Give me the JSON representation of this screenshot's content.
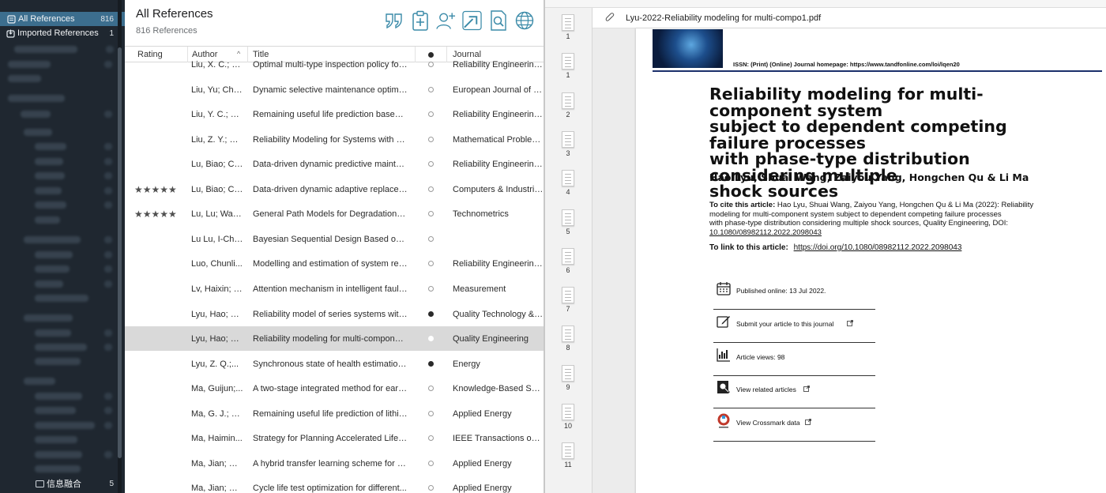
{
  "sidebar": {
    "items": [
      {
        "label": "All References",
        "count": "816",
        "icon": "library-icon",
        "selected": true
      },
      {
        "label": "Imported References",
        "count": "1",
        "icon": "import-icon",
        "selected": false
      }
    ],
    "bottom_label": "信息融合",
    "bottom_count": "5"
  },
  "list": {
    "title": "All References",
    "subtitle": "816 References",
    "toolbar": [
      {
        "name": "quote-icon"
      },
      {
        "name": "clipboard-add-icon"
      },
      {
        "name": "add-user-icon"
      },
      {
        "name": "share-arrow-icon"
      },
      {
        "name": "find-document-icon"
      },
      {
        "name": "globe-icon"
      }
    ],
    "columns": {
      "rating": "Rating",
      "author": "Author",
      "title": "Title",
      "journal": "Journal"
    },
    "rows": [
      {
        "rating": "",
        "author": "Liu, X. C.; S...",
        "title": "Optimal multi-type inspection policy for...",
        "dot": "empty",
        "journal": "Reliability Engineering & ..."
      },
      {
        "rating": "",
        "author": "Liu, Yu; Che...",
        "title": "Dynamic selective maintenance optimiz...",
        "dot": "empty",
        "journal": "European Journal of Oper..."
      },
      {
        "rating": "",
        "author": "Liu, Y. C.; H...",
        "title": "Remaining useful life prediction based o...",
        "dot": "empty",
        "journal": "Reliability Engineering & ..."
      },
      {
        "rating": "",
        "author": "Liu, Z. Y.; M...",
        "title": "Reliability Modeling for Systems with Mu...",
        "dot": "empty",
        "journal": "Mathematical Problems in..."
      },
      {
        "rating": "",
        "author": "Lu, Biao; Ch...",
        "title": "Data-driven dynamic predictive mainten...",
        "dot": "empty",
        "journal": "Reliability Engineering & ..."
      },
      {
        "rating": "★★★★★",
        "author": "Lu, Biao; Ch...",
        "title": "Data-driven dynamic adaptive replacem...",
        "dot": "empty",
        "journal": "Computers & Industrial E..."
      },
      {
        "rating": "★★★★★",
        "author": "Lu, Lu; Wan...",
        "title": "General Path Models for Degradation Da...",
        "dot": "empty",
        "journal": "Technometrics"
      },
      {
        "rating": "",
        "author": "Lu Lu, I-Che...",
        "title": "Bayesian Sequential Design Based on D...",
        "dot": "empty",
        "journal": ""
      },
      {
        "rating": "",
        "author": "Luo, Chunli...",
        "title": "Modelling and estimation of system relia...",
        "dot": "empty",
        "journal": "Reliability Engineering & ..."
      },
      {
        "rating": "",
        "author": "Lv, Haixin; C...",
        "title": "Attention mechanism in intelligent fault...",
        "dot": "empty",
        "journal": "Measurement"
      },
      {
        "rating": "",
        "author": "Lyu, Hao; Q...",
        "title": "Reliability model of series systems with...",
        "dot": "filled",
        "journal": "Quality Technology & Qu..."
      },
      {
        "rating": "",
        "author": "Lyu, Hao; W...",
        "title": "Reliability modeling for multi-componen...",
        "dot": "selected",
        "journal": "Quality Engineering",
        "selected": true
      },
      {
        "rating": "",
        "author": "Lyu, Z. Q.;...",
        "title": "Synchronous state of health estimation...",
        "dot": "filled",
        "journal": "Energy"
      },
      {
        "rating": "",
        "author": "Ma, Guijun;...",
        "title": "A two-stage integrated method for early...",
        "dot": "empty",
        "journal": "Knowledge-Based Systems"
      },
      {
        "rating": "",
        "author": "Ma, G. J.; Z...",
        "title": "Remaining useful life prediction of lithiu...",
        "dot": "empty",
        "journal": "Applied Energy"
      },
      {
        "rating": "",
        "author": "Ma, Haimin...",
        "title": "Strategy for Planning Accelerated Life T...",
        "dot": "empty",
        "journal": "IEEE Transactions on Reli..."
      },
      {
        "rating": "",
        "author": "Ma, Jian; Sh...",
        "title": "A hybrid transfer learning scheme for re...",
        "dot": "empty",
        "journal": "Applied Energy"
      },
      {
        "rating": "",
        "author": "Ma, Jian; Xu...",
        "title": "Cycle life test optimization for different...",
        "dot": "empty",
        "journal": "Applied Energy"
      }
    ]
  },
  "pdf": {
    "filename": "Lyu-2022-Reliability modeling for multi-compo1.pdf",
    "thumbnails": [
      "1",
      "1",
      "2",
      "3",
      "4",
      "5",
      "6",
      "7",
      "8",
      "9",
      "10",
      "11"
    ],
    "issn_line": "ISSN: (Print) (Online) Journal homepage: https://www.tandfonline.com/loi/lqen20",
    "title_lines": [
      "Reliability modeling for multi-component system",
      "subject to dependent competing failure processes",
      "with phase-type distribution considering multiple",
      "shock sources"
    ],
    "authors": "Hao Lyu, Shuai Wang, Zaiyou Yang, Hongchen Qu & Li Ma",
    "cite_label": "To cite this article:",
    "cite_lines": [
      " Hao Lyu, Shuai Wang, Zaiyou Yang, Hongchen Qu & Li Ma (2022): Reliability",
      "modeling for multi-component system subject to dependent competing failure processes",
      "with phase-type distribution considering multiple shock sources, Quality Engineering, DOI:",
      "10.1080/08982112.2022.2098043"
    ],
    "link_label": "To link to this article:",
    "link_url": "https://doi.org/10.1080/08982112.2022.2098043",
    "meta": [
      {
        "icon": "calendar-icon",
        "text": "Published online: 13 Jul 2022."
      },
      {
        "icon": "edit-icon",
        "text": "Submit your article to this journal"
      },
      {
        "icon": "bar-chart-icon",
        "text": "Article views: 98"
      },
      {
        "icon": "search-doc-icon",
        "text": "View related articles"
      },
      {
        "icon": "crossmark-icon",
        "text": "View Crossmark data"
      }
    ]
  }
}
